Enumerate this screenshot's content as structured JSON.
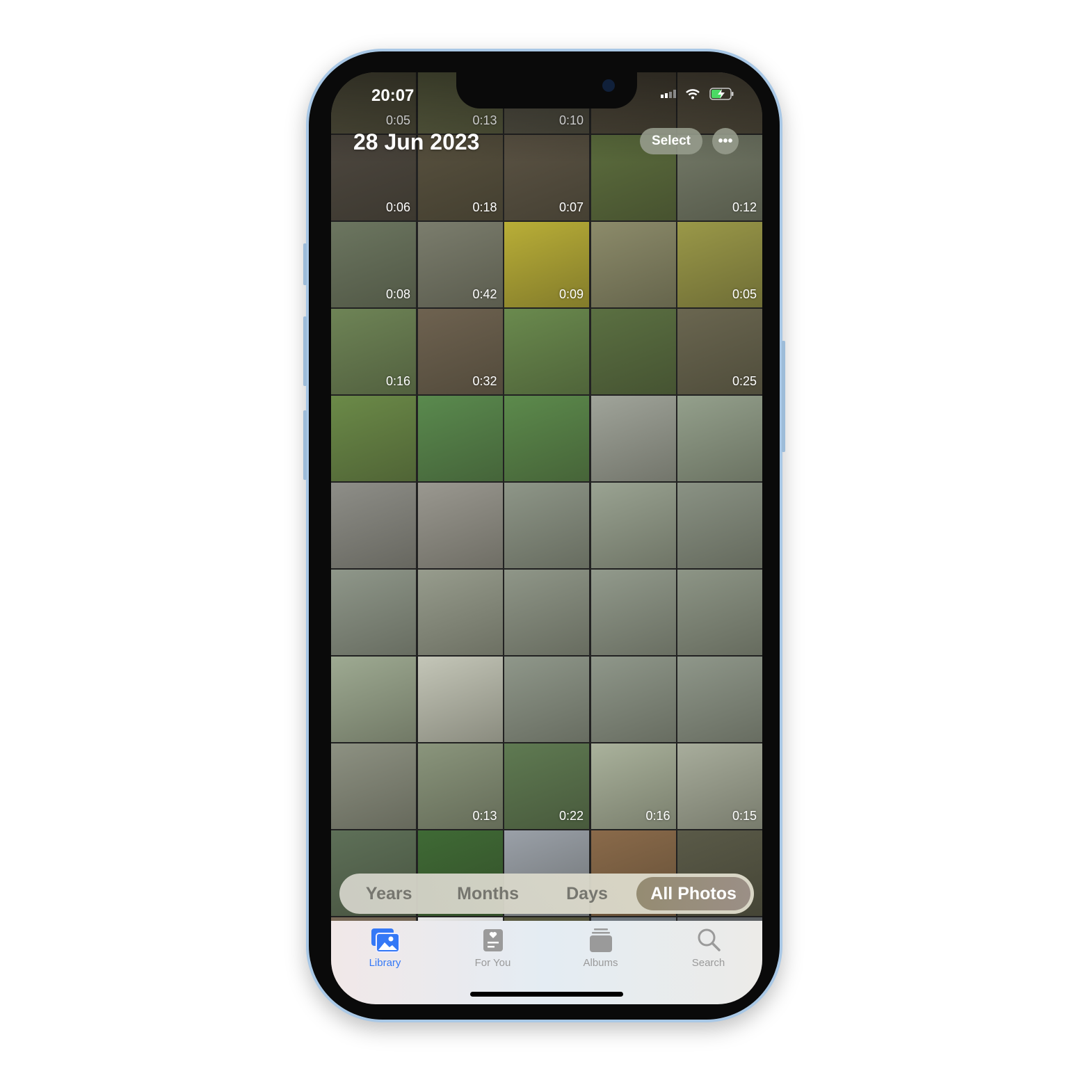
{
  "status_bar": {
    "time": "20:07",
    "icons": [
      "cellular-signal-icon",
      "wifi-icon",
      "battery-charging-icon"
    ]
  },
  "header": {
    "date": "28 Jun 2023",
    "select_label": "Select",
    "more_label": "•••"
  },
  "grid": {
    "rows": [
      [
        {
          "d": "0:05",
          "c": "#5d5a45"
        },
        {
          "d": "0:13",
          "c": "#6a6e4c"
        },
        {
          "d": "0:10",
          "c": "#5e5b4e"
        },
        {
          "d": "",
          "c": "#5a5243"
        },
        {
          "d": "",
          "c": "#5e5646"
        }
      ],
      [
        {
          "d": "0:06",
          "c": "#4d473f"
        },
        {
          "d": "0:18",
          "c": "#58513f"
        },
        {
          "d": "0:07",
          "c": "#5b5344"
        },
        {
          "d": "",
          "c": "#5d6e3e"
        },
        {
          "d": "0:12",
          "c": "#747a68"
        }
      ],
      [
        {
          "d": "0:08",
          "c": "#6c7660"
        },
        {
          "d": "0:42",
          "c": "#7b7d6d"
        },
        {
          "d": "0:09",
          "c": "#b9ae37"
        },
        {
          "d": "",
          "c": "#8c8b6a"
        },
        {
          "d": "0:05",
          "c": "#9a9848"
        }
      ],
      [
        {
          "d": "0:16",
          "c": "#6e8456"
        },
        {
          "d": "0:32",
          "c": "#6e6250"
        },
        {
          "d": "",
          "c": "#6a8a4e"
        },
        {
          "d": "",
          "c": "#5b7042"
        },
        {
          "d": "0:25",
          "c": "#6a6650"
        }
      ],
      [
        {
          "d": "",
          "c": "#6b8a48"
        },
        {
          "d": "",
          "c": "#5a8a4e"
        },
        {
          "d": "",
          "c": "#5c8a4c"
        },
        {
          "d": "",
          "c": "#a0a49a"
        },
        {
          "d": "",
          "c": "#94a08c"
        }
      ],
      [
        {
          "d": "",
          "c": "#8e8e88"
        },
        {
          "d": "",
          "c": "#9a9890"
        },
        {
          "d": "",
          "c": "#8e9688"
        },
        {
          "d": "",
          "c": "#9aa392"
        },
        {
          "d": "",
          "c": "#8a9284"
        }
      ],
      [
        {
          "d": "",
          "c": "#8f978a"
        },
        {
          "d": "",
          "c": "#979c8d"
        },
        {
          "d": "",
          "c": "#8f9688"
        },
        {
          "d": "",
          "c": "#929a8c"
        },
        {
          "d": "",
          "c": "#8d9586"
        }
      ],
      [
        {
          "d": "",
          "c": "#9eaa92"
        },
        {
          "d": "",
          "c": "#c4c6b8"
        },
        {
          "d": "",
          "c": "#8f978a"
        },
        {
          "d": "",
          "c": "#8f978a"
        },
        {
          "d": "",
          "c": "#8f978a"
        }
      ],
      [
        {
          "d": "",
          "c": "#8d9182"
        },
        {
          "d": "0:13",
          "c": "#8a957c"
        },
        {
          "d": "0:22",
          "c": "#5f7a52"
        },
        {
          "d": "0:16",
          "c": "#aab29c"
        },
        {
          "d": "0:15",
          "c": "#a8ad9c"
        }
      ],
      [
        {
          "d": "",
          "c": "#5e7058"
        },
        {
          "d": "",
          "c": "#3f6a35"
        },
        {
          "d": "",
          "c": "#9aa0a8"
        },
        {
          "d": "",
          "c": "#8a6a4a"
        },
        {
          "d": "",
          "c": "#5a5a48"
        }
      ],
      [
        {
          "d": "",
          "c": "#7a6a58"
        },
        {
          "d": "",
          "c": "#e8e8e8"
        },
        {
          "d": "",
          "c": "#5a5a40"
        },
        {
          "d": "",
          "c": "#707880"
        },
        {
          "d": "",
          "c": "#606468"
        }
      ]
    ]
  },
  "view_switcher": {
    "items": [
      "Years",
      "Months",
      "Days",
      "All Photos"
    ],
    "active": "All Photos"
  },
  "tabbar": {
    "items": [
      {
        "label": "Library",
        "icon": "photo-library-icon",
        "active": true
      },
      {
        "label": "For You",
        "icon": "for-you-icon",
        "active": false
      },
      {
        "label": "Albums",
        "icon": "albums-icon",
        "active": false
      },
      {
        "label": "Search",
        "icon": "search-icon",
        "active": false
      }
    ]
  },
  "colors": {
    "accent": "#3478f6",
    "tab_inactive": "#9a9a9a",
    "segment_active": "#958c72",
    "frame": "#a9c8e6"
  }
}
